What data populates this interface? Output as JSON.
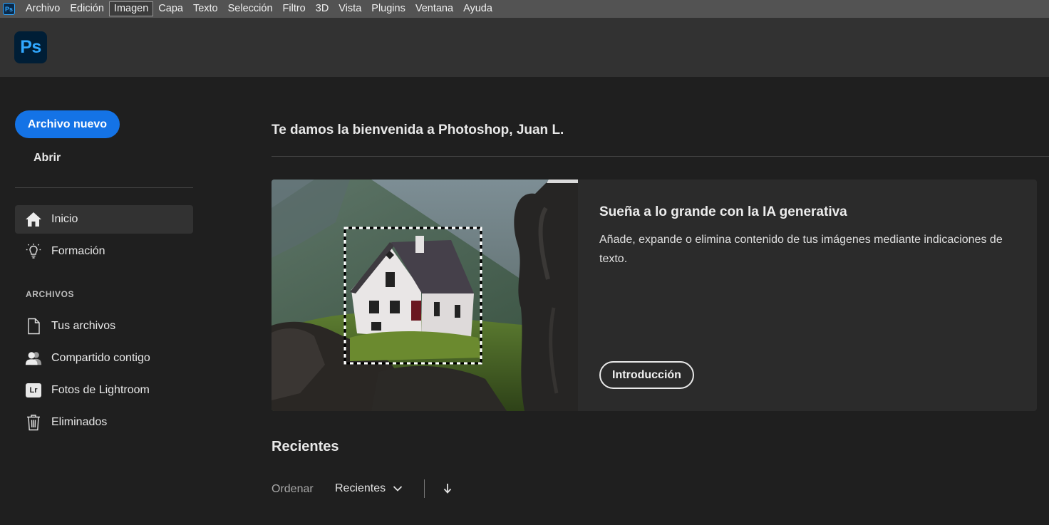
{
  "menubar": {
    "app_badge": "Ps",
    "items": [
      "Archivo",
      "Edición",
      "Imagen",
      "Capa",
      "Texto",
      "Selección",
      "Filtro",
      "3D",
      "Vista",
      "Plugins",
      "Ventana",
      "Ayuda"
    ],
    "active_index": 2
  },
  "header": {
    "logo_text": "Ps"
  },
  "sidebar": {
    "new_file_label": "Archivo nuevo",
    "open_label": "Abrir",
    "nav": [
      {
        "label": "Inicio",
        "icon": "home-icon",
        "selected": true
      },
      {
        "label": "Formación",
        "icon": "lightbulb-icon",
        "selected": false
      }
    ],
    "section_label": "ARCHIVOS",
    "files_nav": [
      {
        "label": "Tus archivos",
        "icon": "document-icon"
      },
      {
        "label": "Compartido contigo",
        "icon": "users-icon"
      },
      {
        "label": "Fotos de Lightroom",
        "icon": "lightroom-icon",
        "icon_text": "Lr"
      },
      {
        "label": "Eliminados",
        "icon": "trash-icon"
      }
    ]
  },
  "main": {
    "welcome": "Te damos la bienvenida a Photoshop, Juan L.",
    "card": {
      "title": "Sueña a lo grande con la IA generativa",
      "description": "Añade, expande o elimina contenido de tus imágenes mediante indicaciones de texto.",
      "button_label": "Introducción"
    },
    "recent": {
      "title": "Recientes",
      "sort_label": "Ordenar",
      "sort_value": "Recientes"
    }
  },
  "colors": {
    "accent": "#1473e6",
    "ps_blue": "#31a8ff",
    "ps_dark": "#001e36",
    "background": "#1f1f1f",
    "header": "#323232",
    "menubar": "#535353"
  }
}
